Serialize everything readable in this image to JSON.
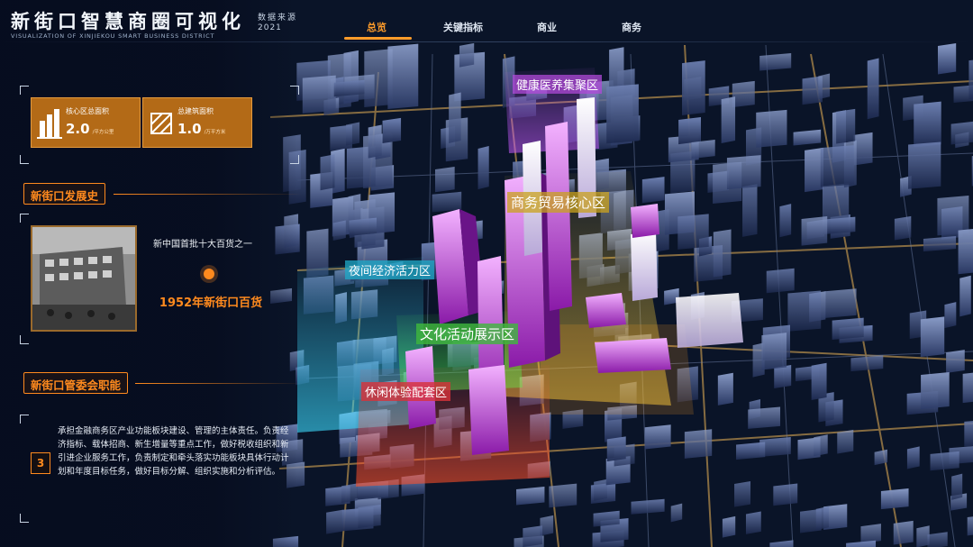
{
  "header": {
    "title": "新街口智慧商圈可视化",
    "subtitle": "VISUALIZATION OF XINJIEKOU SMART BUSINESS DISTRICT",
    "source_label": "数据来源",
    "source_year": "2021"
  },
  "nav": {
    "tabs": [
      {
        "label": "总览",
        "active": true
      },
      {
        "label": "关键指标",
        "active": false
      },
      {
        "label": "商业",
        "active": false
      },
      {
        "label": "商务",
        "active": false
      }
    ],
    "active_color": "#ff9c2a"
  },
  "stats": [
    {
      "label": "核心区总面积",
      "value": "2.0",
      "unit": "/平方公里",
      "icon": "building-chart-icon"
    },
    {
      "label": "总建筑面积",
      "value": "1.0",
      "unit": "/万平方米",
      "icon": "area-frame-icon"
    }
  ],
  "history": {
    "heading": "新街口发展史",
    "caption": "新中国首批十大百货之一",
    "event": "1952年新街口百货",
    "photo_icon": "historic-building-photo"
  },
  "duties": {
    "heading": "新街口管委会职能",
    "number": "3",
    "text": "承担金融商务区产业功能板块建设、管理的主体责任。负责经济指标、载体招商、新生增量等重点工作，做好税收组织和新引进企业服务工作，负责制定和牵头落实功能板块具体行动计划和年度目标任务，做好目标分解、组织实施和分析评估。"
  },
  "zones": [
    {
      "name": "健康医养集聚区",
      "color": "#b04ad8"
    },
    {
      "name": "商务贸易核心区",
      "color": "#c9a21e"
    },
    {
      "name": "夜间经济活力区",
      "color": "#1fa9c8"
    },
    {
      "name": "文化活动展示区",
      "color": "#3fb83c"
    },
    {
      "name": "休闲体验配套区",
      "color": "#d8323a"
    }
  ],
  "colors": {
    "accent": "#ff8a1e",
    "stat_card": "#b36a17",
    "background": "#060d1e"
  }
}
